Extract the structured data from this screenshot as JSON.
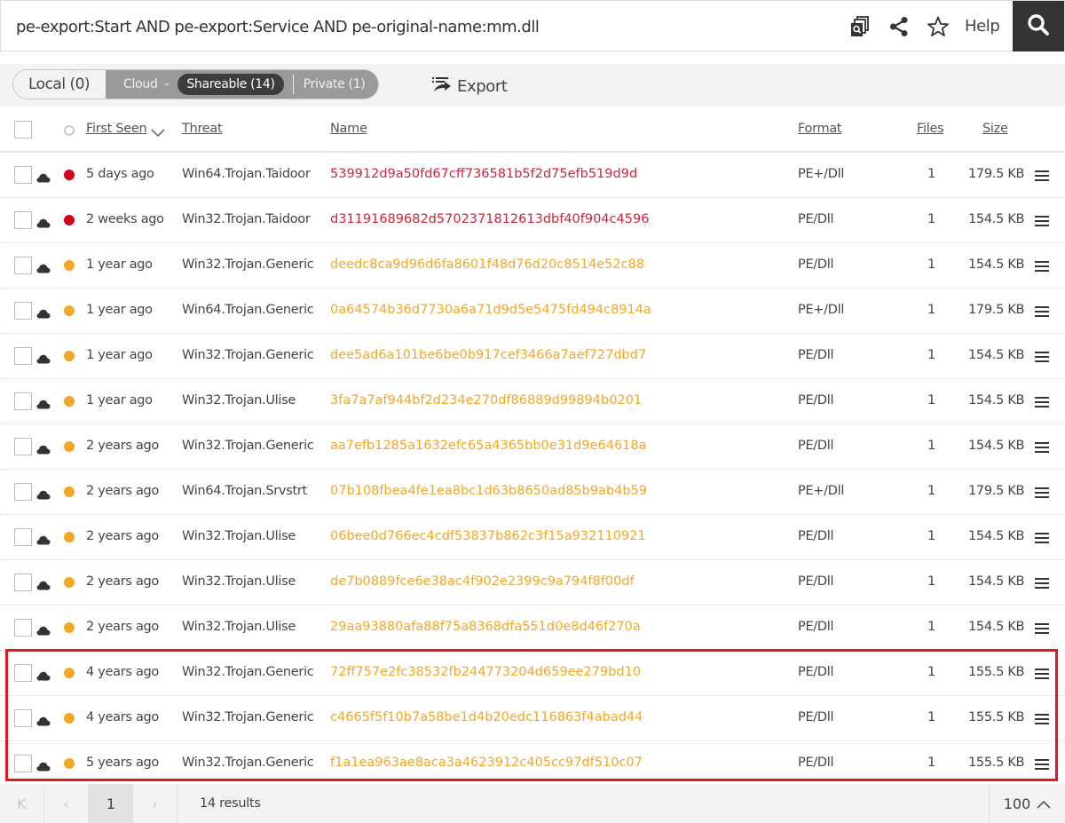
{
  "search": {
    "query": "pe-export:Start AND pe-export:Service AND pe-original-name:mm.dll",
    "icons": [
      "bulk-search-icon",
      "share-icon",
      "star-icon",
      "search-icon"
    ],
    "help_label": "Help"
  },
  "toolbar": {
    "local_label": "Local (0)",
    "cloud_label": "Cloud",
    "cloud_separator": "-",
    "shareable_label": "Shareable (14)",
    "private_label": "Private (1)",
    "export_label": "Export"
  },
  "table": {
    "columns": {
      "first_seen": "First Seen",
      "threat": "Threat",
      "name": "Name",
      "format": "Format",
      "files": "Files",
      "size": "Size"
    },
    "sort": {
      "column": "First Seen",
      "direction": "descending"
    },
    "colors": {
      "malicious": "#d0021b",
      "suspicious": "#f5a623",
      "name_malicious": "#d0243a",
      "name_suspicious": "#f5a623"
    },
    "rows": [
      {
        "first_seen": "5 days ago",
        "threat": "Win64.Trojan.Taidoor",
        "name": "539912d9a50fd67cff736581b5f2d75efb519d9d",
        "format": "PE+/Dll",
        "files": "1",
        "size": "179.5 KB",
        "status": "malicious"
      },
      {
        "first_seen": "2 weeks ago",
        "threat": "Win32.Trojan.Taidoor",
        "name": "d31191689682d5702371812613dbf40f904c4596",
        "format": "PE/Dll",
        "files": "1",
        "size": "154.5 KB",
        "status": "malicious"
      },
      {
        "first_seen": "1 year ago",
        "threat": "Win32.Trojan.Generic",
        "name": "deedc8ca9d96d6fa8601f48d76d20c8514e52c88",
        "format": "PE/Dll",
        "files": "1",
        "size": "154.5 KB",
        "status": "suspicious"
      },
      {
        "first_seen": "1 year ago",
        "threat": "Win64.Trojan.Generic",
        "name": "0a64574b36d7730a6a71d9d5e5475fd494c8914a",
        "format": "PE+/Dll",
        "files": "1",
        "size": "179.5 KB",
        "status": "suspicious"
      },
      {
        "first_seen": "1 year ago",
        "threat": "Win32.Trojan.Generic",
        "name": "dee5ad6a101be6be0b917cef3466a7aef727dbd7",
        "format": "PE/Dll",
        "files": "1",
        "size": "154.5 KB",
        "status": "suspicious"
      },
      {
        "first_seen": "1 year ago",
        "threat": "Win32.Trojan.Ulise",
        "name": "3fa7a7af944bf2d234e270df86889d99894b0201",
        "format": "PE/Dll",
        "files": "1",
        "size": "154.5 KB",
        "status": "suspicious"
      },
      {
        "first_seen": "2 years ago",
        "threat": "Win32.Trojan.Generic",
        "name": "aa7efb1285a1632efc65a4365bb0e31d9e64618a",
        "format": "PE/Dll",
        "files": "1",
        "size": "154.5 KB",
        "status": "suspicious"
      },
      {
        "first_seen": "2 years ago",
        "threat": "Win64.Trojan.Srvstrt",
        "name": "07b108fbea4fe1ea8bc1d63b8650ad85b9ab4b59",
        "format": "PE+/Dll",
        "files": "1",
        "size": "179.5 KB",
        "status": "suspicious"
      },
      {
        "first_seen": "2 years ago",
        "threat": "Win32.Trojan.Ulise",
        "name": "06bee0d766ec4cdf53837b862c3f15a932110921",
        "format": "PE/Dll",
        "files": "1",
        "size": "154.5 KB",
        "status": "suspicious"
      },
      {
        "first_seen": "2 years ago",
        "threat": "Win32.Trojan.Ulise",
        "name": "de7b0889fce6e38ac4f902e2399c9a794f8f00df",
        "format": "PE/Dll",
        "files": "1",
        "size": "154.5 KB",
        "status": "suspicious"
      },
      {
        "first_seen": "2 years ago",
        "threat": "Win32.Trojan.Ulise",
        "name": "29aa93880afa88f75a8368dfa551d0e8d46f270a",
        "format": "PE/Dll",
        "files": "1",
        "size": "154.5 KB",
        "status": "suspicious"
      },
      {
        "first_seen": "4 years ago",
        "threat": "Win32.Trojan.Generic",
        "name": "72ff757e2fc38532fb244773204d659ee279bd10",
        "format": "PE/Dll",
        "files": "1",
        "size": "155.5 KB",
        "status": "suspicious"
      },
      {
        "first_seen": "4 years ago",
        "threat": "Win32.Trojan.Generic",
        "name": "c4665f5f10b7a58be1d4b20edc116863f4abad44",
        "format": "PE/Dll",
        "files": "1",
        "size": "155.5 KB",
        "status": "suspicious"
      },
      {
        "first_seen": "5 years ago",
        "threat": "Win32.Trojan.Generic",
        "name": "f1a1ea963ae8aca3a4623912c405cc97df510c07",
        "format": "PE/Dll",
        "files": "1",
        "size": "155.5 KB",
        "status": "suspicious"
      }
    ],
    "highlighted_rows": [
      11,
      12,
      13
    ],
    "highlight_color": "#e4161e"
  },
  "pagination": {
    "first_label": "K",
    "prev_label": "‹",
    "current_page": "1",
    "next_label": "›",
    "results_label": "14 results",
    "per_page": "100"
  }
}
